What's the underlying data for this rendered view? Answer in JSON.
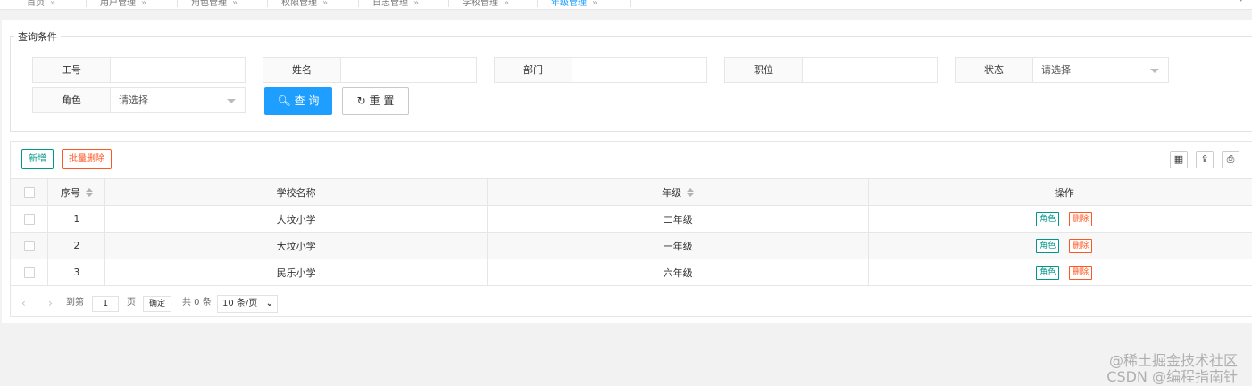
{
  "tabs": {
    "items": [
      {
        "label": "首页"
      },
      {
        "label": "用户管理"
      },
      {
        "label": "角色管理"
      },
      {
        "label": "权限管理"
      },
      {
        "label": "日志管理"
      },
      {
        "label": "学校管理"
      },
      {
        "label": "年级管理"
      }
    ],
    "close_glyph": "»",
    "scroll_glyph": "▾",
    "active_color": "#1e9fff"
  },
  "filter": {
    "legend": "查询条件",
    "fields": {
      "employee_no": {
        "label": "工号",
        "value": ""
      },
      "name": {
        "label": "姓名",
        "value": ""
      },
      "department": {
        "label": "部门",
        "value": ""
      },
      "position": {
        "label": "职位",
        "value": ""
      },
      "status": {
        "label": "状态",
        "value": "请选择"
      },
      "role": {
        "label": "角色",
        "value": "请选择"
      }
    },
    "query_button": "查 询",
    "reset_button": "重 置",
    "query_color": "#1e9fff"
  },
  "toolbar": {
    "add_button": "新增",
    "batch_delete_button": "批量删除",
    "icons": [
      "columns-icon",
      "export-icon",
      "print-icon"
    ],
    "add_color": "#009688",
    "delete_color": "#ff5722"
  },
  "table": {
    "headers": {
      "index": "序号",
      "school": "学校名称",
      "grade": "年级",
      "actions": "操作"
    },
    "rows": [
      {
        "index": "1",
        "school": "大坟小学",
        "grade": "二年级",
        "role_btn": "角色",
        "delete_btn": "删除"
      },
      {
        "index": "2",
        "school": "大坟小学",
        "grade": "一年级",
        "role_btn": "角色",
        "delete_btn": "删除"
      },
      {
        "index": "3",
        "school": "民乐小学",
        "grade": "六年级",
        "role_btn": "角色",
        "delete_btn": "删除"
      }
    ]
  },
  "pager": {
    "prev": "‹",
    "next": "›",
    "goto_label": "到第",
    "page_value": "1",
    "page_unit": "页",
    "confirm_button": "确定",
    "total": "共 0 条",
    "page_size": "10 条/页"
  },
  "watermark": {
    "line1": "@稀土掘金技术社区",
    "line2": "CSDN @编程指南针"
  }
}
